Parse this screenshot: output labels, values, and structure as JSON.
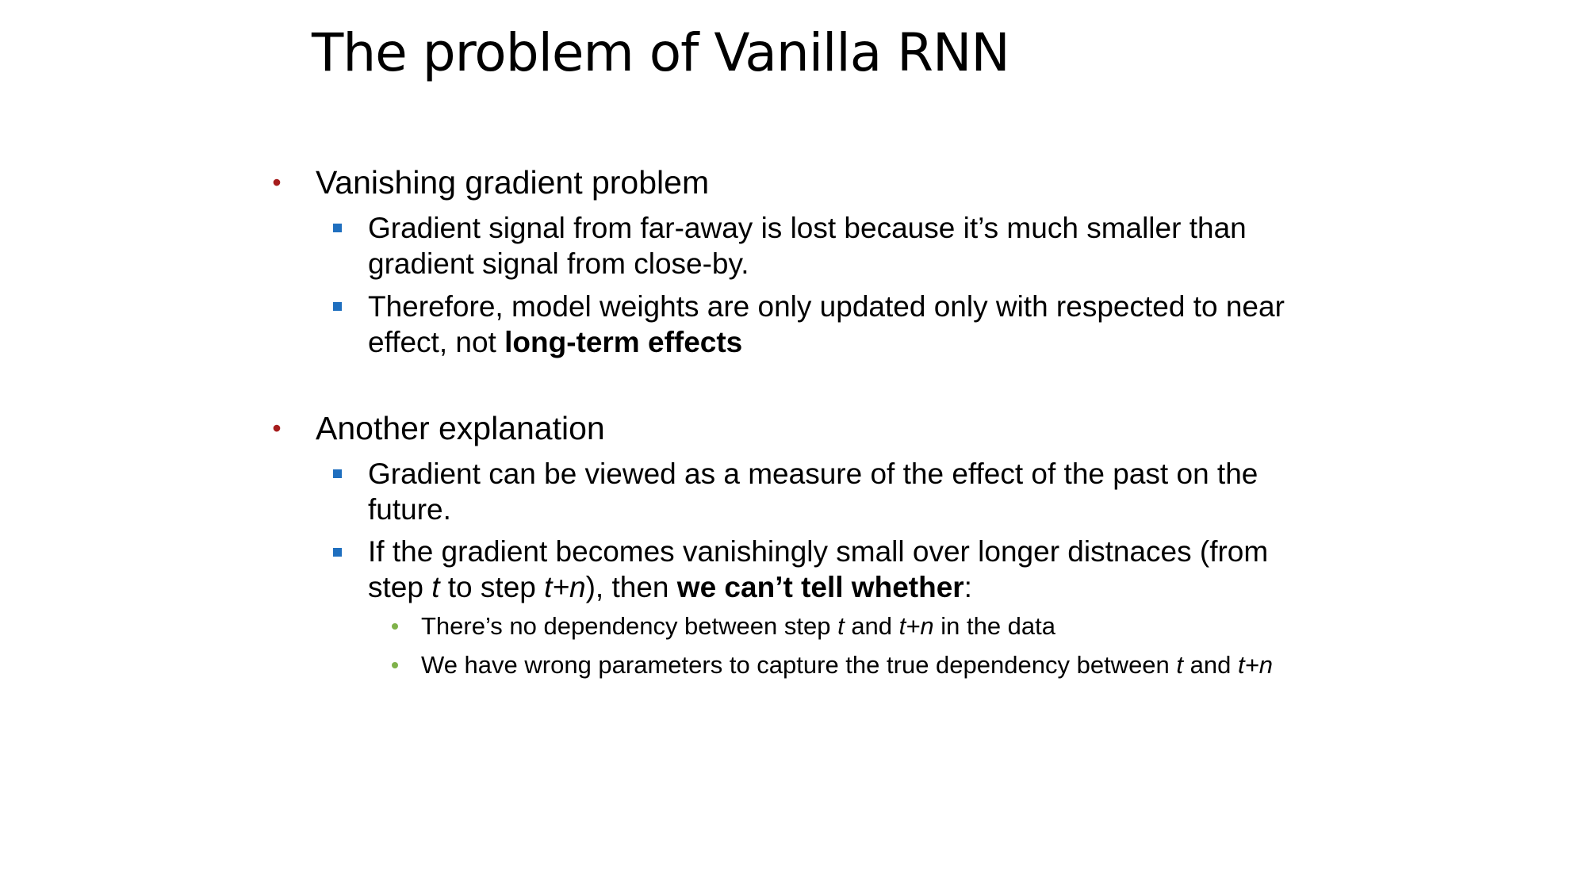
{
  "slide": {
    "title": "The problem of Vanilla RNN",
    "colors": {
      "level1_bullet": "#a61c1c",
      "level2_bullet": "#1f6fbf",
      "level3_bullet": "#7fb24a"
    },
    "sections": [
      {
        "heading": "Vanishing gradient problem",
        "points": [
          {
            "text": "Gradient signal from far-away is lost because it’s much smaller than gradient signal from close-by."
          },
          {
            "prefix": "Therefore, model weights are only updated only with respected to near effect, not ",
            "bold": "long-term effects"
          }
        ]
      },
      {
        "heading": "Another explanation",
        "points": [
          {
            "text": "Gradient can be viewed as a measure of the effect of the past on the future."
          },
          {
            "p1": "If the gradient becomes vanishingly small over longer distnaces (from step ",
            "t": "t",
            "p2": " to step ",
            "tn": "t+n",
            "p3": "), then ",
            "bold": "we can’t tell whether",
            "p4": ":",
            "subpoints": [
              {
                "p1": "There’s no dependency between step ",
                "t": "t",
                "p2": " and ",
                "tn": "t+n",
                "p3": " in the data"
              },
              {
                "p1": "We have wrong parameters to capture the true dependency between ",
                "t": "t",
                "p2": " and ",
                "tn": "t+n"
              }
            ]
          }
        ]
      }
    ]
  }
}
